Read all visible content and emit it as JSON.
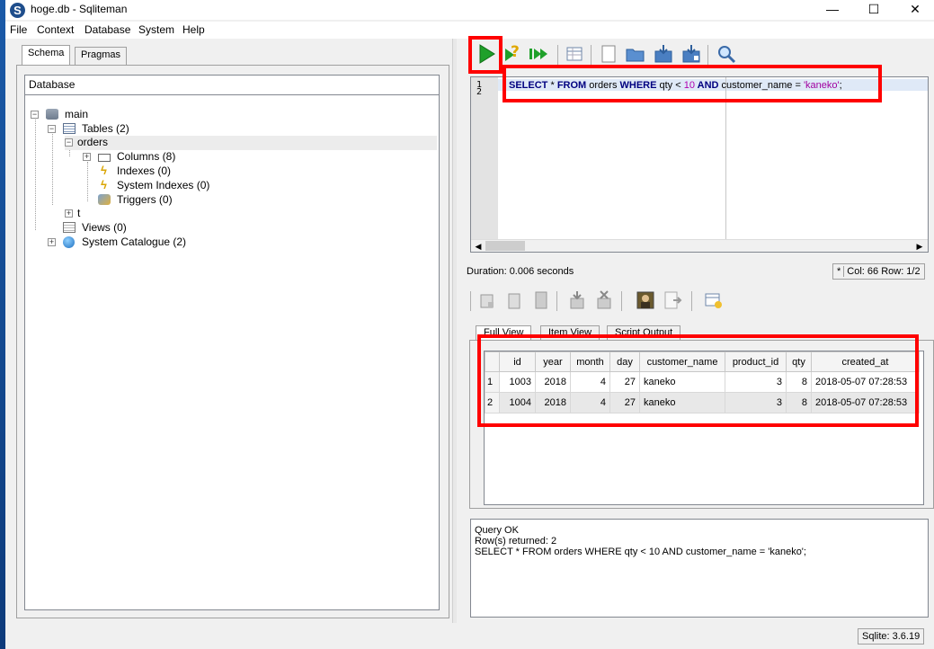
{
  "window": {
    "title": "hoge.db - Sqliteman",
    "app_icon": "S",
    "min": "—",
    "max": "☐",
    "close": "✕"
  },
  "menu": [
    "File",
    "Context",
    "Database",
    "System",
    "Help"
  ],
  "left_tabs": [
    "Schema",
    "Pragmas"
  ],
  "tree": {
    "header": "Database",
    "main": "main",
    "tables": "Tables (2)",
    "orders": "orders",
    "columns": "Columns (8)",
    "indexes": "Indexes (0)",
    "system_indexes": "System Indexes (0)",
    "triggers": "Triggers (0)",
    "t": "t",
    "views": "Views (0)",
    "system_catalogue": "System Catalogue (2)"
  },
  "toolbar_icons": [
    "run-query-icon",
    "explain-query-icon",
    "run-script-icon",
    "query-history-icon",
    "new-file-icon",
    "open-file-icon",
    "save-file-icon",
    "save-as-icon",
    "search-icon"
  ],
  "editor": {
    "line_numbers": [
      "1",
      "2"
    ],
    "sql": {
      "select": "SELECT",
      "star": " * ",
      "from": "FROM",
      "table": " orders ",
      "where": "WHERE",
      "cond1": " qty < ",
      "num": "10",
      "and": " AND",
      "cond2": " customer_name = ",
      "str": "'kaneko'",
      "end": ";"
    }
  },
  "duration": "Duration: 0.006 seconds",
  "cursor": {
    "modified": "*",
    "position": "Col: 66 Row: 1/2"
  },
  "result_tabs": [
    "Full View",
    "Item View",
    "Script Output"
  ],
  "result": {
    "columns": [
      "id",
      "year",
      "month",
      "day",
      "customer_name",
      "product_id",
      "qty",
      "created_at"
    ],
    "rows": [
      [
        "1",
        "1003",
        "2018",
        "4",
        "27",
        "kaneko",
        "3",
        "8",
        "2018-05-07 07:28:53"
      ],
      [
        "2",
        "1004",
        "2018",
        "4",
        "27",
        "kaneko",
        "3",
        "8",
        "2018-05-07 07:28:53"
      ]
    ]
  },
  "messages": {
    "line1": "Query OK",
    "line2": "Row(s) returned: 2",
    "line3": "SELECT * FROM orders WHERE qty < 10 AND customer_name = 'kaneko';"
  },
  "sqlite_version": "Sqlite: 3.6.19",
  "colors": {
    "annotation": "#ff0000",
    "run_green": "#1fa02a",
    "keyword": "#000080"
  }
}
